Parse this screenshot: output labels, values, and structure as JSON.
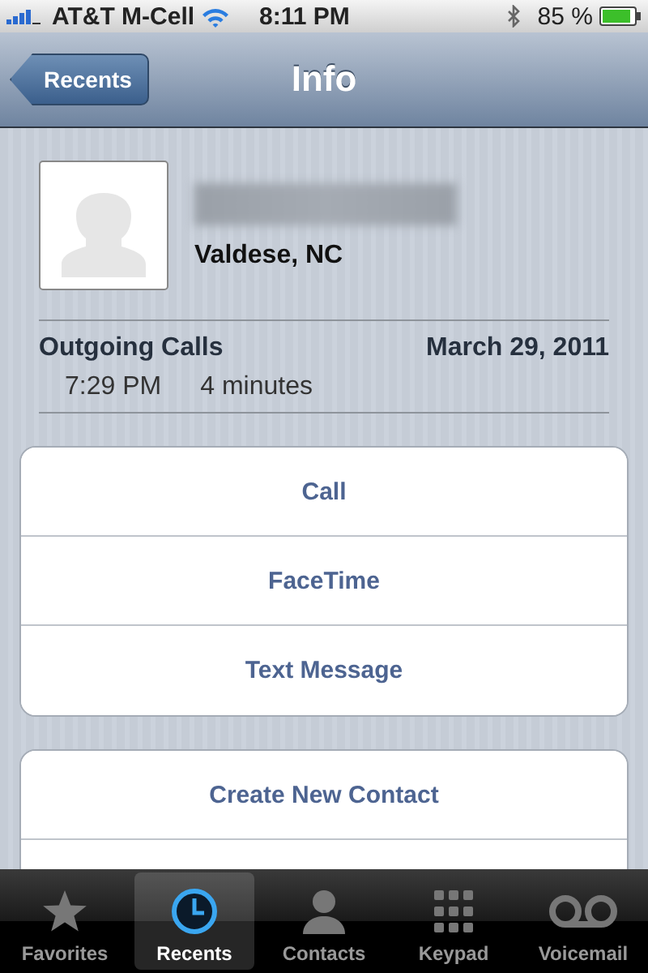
{
  "status_bar": {
    "carrier": "AT&T M-Cell",
    "time": "8:11 PM",
    "battery": "85 %"
  },
  "nav_bar": {
    "back": "Recents",
    "title": "Info"
  },
  "contact": {
    "location": "Valdese, NC"
  },
  "call_log": {
    "heading": "Outgoing Calls",
    "date": "March 29, 2011",
    "entries": [
      {
        "time": "7:29 PM",
        "duration": "4 minutes"
      }
    ]
  },
  "action_groups": [
    {
      "items": [
        "Call",
        "FaceTime",
        "Text Message"
      ]
    },
    {
      "items": [
        "Create New Contact"
      ]
    }
  ],
  "tabs": [
    {
      "label": "Favorites",
      "kind": "star",
      "selected": false
    },
    {
      "label": "Recents",
      "kind": "clock",
      "selected": true
    },
    {
      "label": "Contacts",
      "kind": "person",
      "selected": false
    },
    {
      "label": "Keypad",
      "kind": "keypad",
      "selected": false
    },
    {
      "label": "Voicemail",
      "kind": "voicemail",
      "selected": false
    }
  ]
}
